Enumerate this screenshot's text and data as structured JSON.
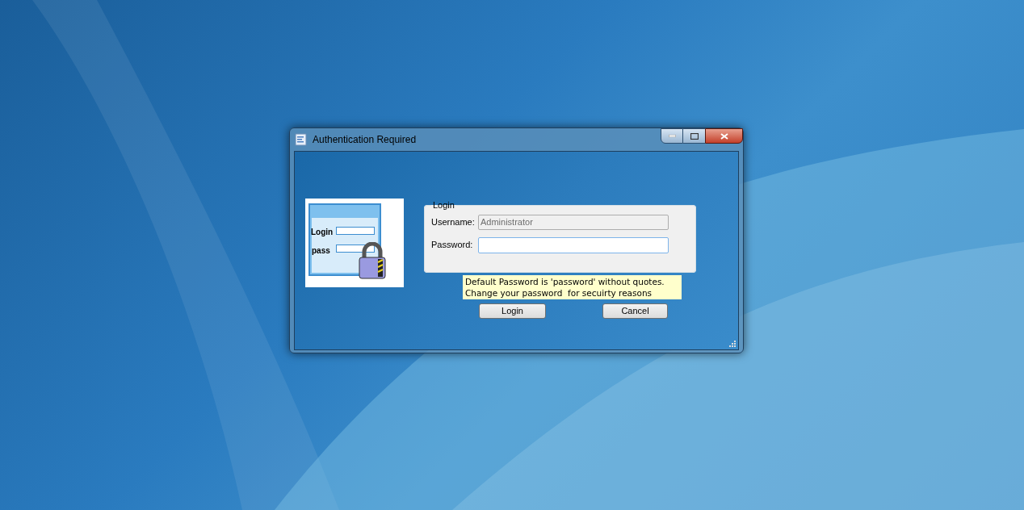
{
  "window": {
    "title": "Authentication Required"
  },
  "illustration": {
    "labels": [
      "Login",
      "pass"
    ]
  },
  "login_group": {
    "title": "Login",
    "fields": [
      {
        "label": "Username:",
        "value": "Administrator",
        "disabled": true
      },
      {
        "label": "Password:",
        "disabled": false
      }
    ]
  },
  "hint": [
    "Default Password is 'password' without quotes.",
    "Change your password  for secuirty reasons"
  ],
  "buttons": [
    "Login",
    "Cancel"
  ]
}
